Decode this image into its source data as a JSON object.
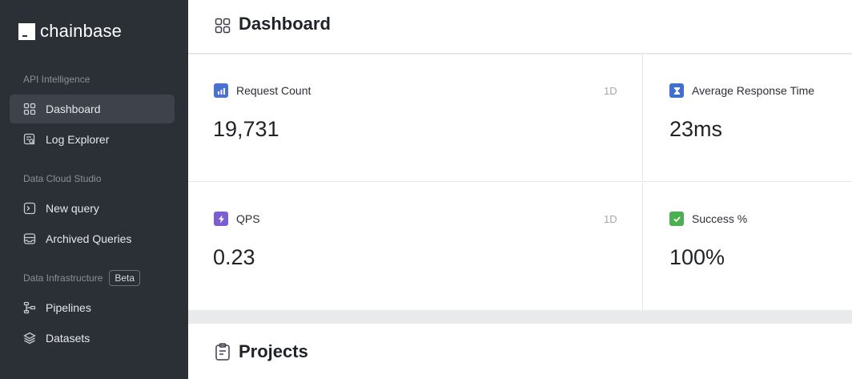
{
  "brand": {
    "name": "chainbase"
  },
  "sidebar": {
    "sections": [
      {
        "label": "API Intelligence"
      },
      {
        "label": "Data Cloud Studio"
      },
      {
        "label": "Data Infrastructure",
        "badge": "Beta"
      }
    ],
    "items": [
      {
        "label": "Dashboard",
        "icon": "grid-icon",
        "active": true
      },
      {
        "label": "Log Explorer",
        "icon": "log-search-icon"
      },
      {
        "label": "New query",
        "icon": "terminal-icon"
      },
      {
        "label": "Archived Queries",
        "icon": "archive-icon"
      },
      {
        "label": "Pipelines",
        "icon": "pipeline-icon"
      },
      {
        "label": "Datasets",
        "icon": "layers-icon"
      }
    ]
  },
  "header": {
    "title": "Dashboard",
    "icon": "grid-icon"
  },
  "stats": [
    {
      "label": "Request Count",
      "range": "1D",
      "value": "19,731",
      "icon": "bar-chart-icon",
      "color": "#4a72d0"
    },
    {
      "label": "Average Response Time",
      "value": "23ms",
      "icon": "hourglass-icon",
      "color": "#3f6fd1"
    },
    {
      "label": "QPS",
      "range": "1D",
      "value": "0.23",
      "icon": "lightning-icon",
      "color": "#7b5ed1"
    },
    {
      "label": "Success %",
      "value": "100%",
      "icon": "check-icon",
      "color": "#4caf50"
    }
  ],
  "projects": {
    "title": "Projects",
    "icon": "clipboard-icon"
  },
  "colors": {
    "sidebar_bg": "#2b2f36",
    "active_item_bg": "#3d424b",
    "main_bg": "#e9eaec"
  }
}
